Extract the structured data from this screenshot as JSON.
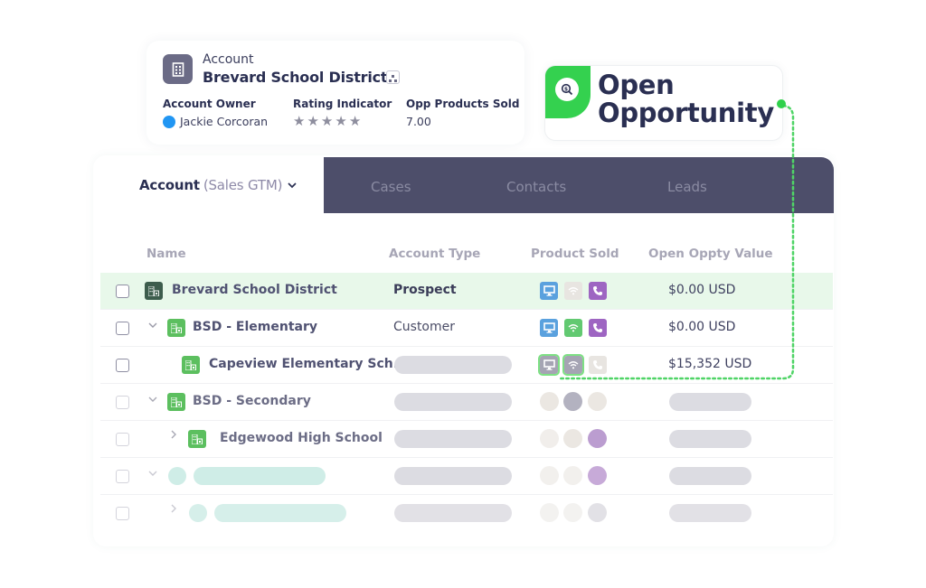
{
  "account_card": {
    "label": "Account",
    "name": "Brevard School District",
    "fields": [
      {
        "label": "Account Owner",
        "value": "Jackie Corcoran"
      },
      {
        "label": "Rating Indicator",
        "stars": 5,
        "rating": 0
      },
      {
        "label": "Opp Products Sold",
        "value": "7.00"
      }
    ]
  },
  "badge": {
    "line1": "Open",
    "line2": "Opportunity",
    "icon": "dollar-search-icon",
    "accent": "#34d14f"
  },
  "tabs": {
    "active_label": "Account",
    "active_sub": "(Sales GTM)",
    "items": [
      "Cases",
      "Contacts",
      "Leads"
    ]
  },
  "table": {
    "columns": [
      "Name",
      "Account Type",
      "Product Sold",
      "Open Oppty Value"
    ],
    "rows": [
      {
        "name": "Brevard School District",
        "type": "Prospect",
        "products": [
          "desktop",
          "wifi-off",
          "phone"
        ],
        "value": "$0.00 USD",
        "highlight": true
      },
      {
        "name": "BSD - Elementary",
        "type": "Customer",
        "products": [
          "desktop",
          "wifi",
          "phone"
        ],
        "value": "$0.00 USD"
      },
      {
        "name": "Capeview Elementary Sch.",
        "type": "",
        "products": [
          "desktop-selected",
          "wifi-selected",
          "phone-off"
        ],
        "value": "$15,352 USD"
      },
      {
        "name": "BSD - Secondary",
        "type": "",
        "products": [],
        "value": ""
      },
      {
        "name": "Edgewood High School",
        "type": "",
        "products": [],
        "value": ""
      },
      {
        "name": "",
        "type": "",
        "products": [],
        "value": ""
      },
      {
        "name": "",
        "type": "",
        "products": [],
        "value": ""
      }
    ]
  },
  "colors": {
    "tab_strip": "#4d4e6a",
    "highlight_row": "#e8f8ea",
    "connector": "#2fd14b"
  }
}
